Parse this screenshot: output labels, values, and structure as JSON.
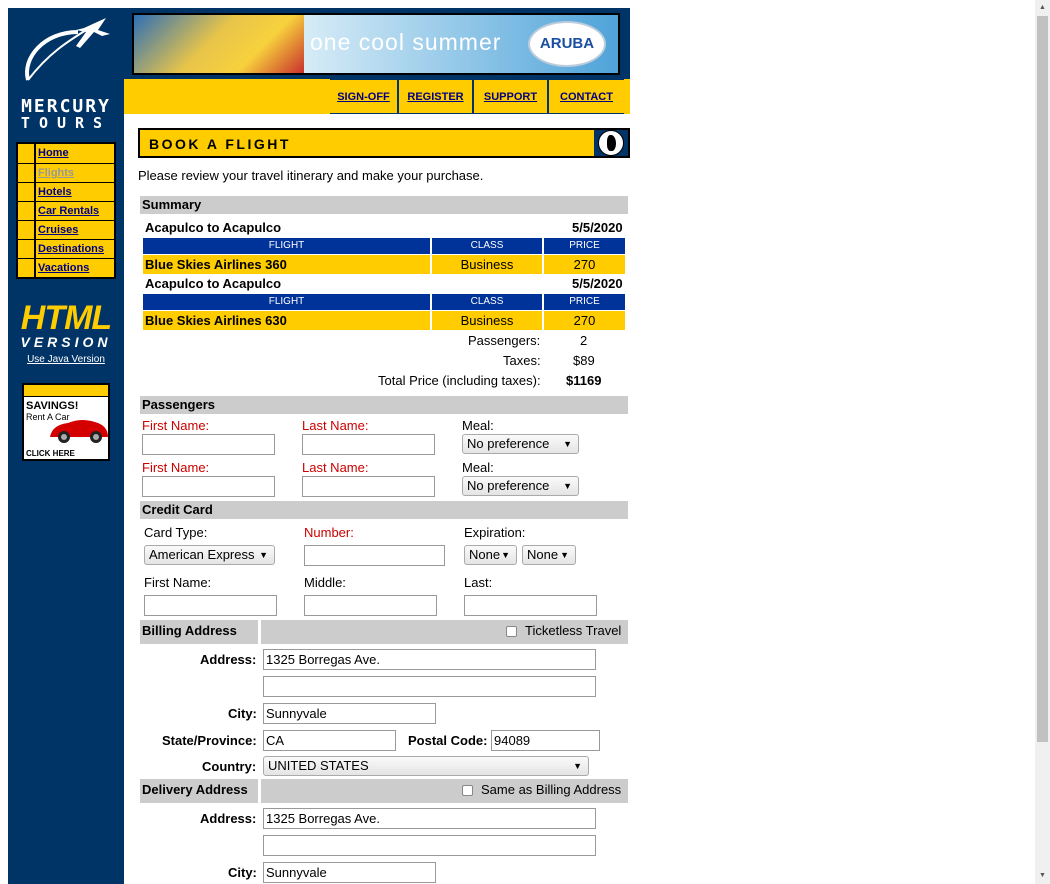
{
  "sidebar": {
    "logo_line1": "MERCURY",
    "logo_line2": "TOURS",
    "nav": [
      {
        "label": "Home"
      },
      {
        "label": "Flights"
      },
      {
        "label": "Hotels"
      },
      {
        "label": "Car Rentals"
      },
      {
        "label": "Cruises"
      },
      {
        "label": "Destinations"
      },
      {
        "label": "Vacations"
      }
    ],
    "html_logo_top": "HTML",
    "html_logo_bottom": "VERSION",
    "java_link": "Use Java Version",
    "ad": {
      "headline": "SAVINGS!",
      "sub": "Rent A Car",
      "cta": "CLICK HERE"
    }
  },
  "banner": {
    "text": "one cool summer",
    "badge": "ARUBA"
  },
  "topnav": [
    "SIGN-OFF",
    "REGISTER",
    "SUPPORT",
    "CONTACT"
  ],
  "page_title": "BOOK A FLIGHT",
  "intro": "Please review your travel itinerary and make your purchase.",
  "summary": {
    "heading": "Summary",
    "legs": [
      {
        "route": "Acapulco to Acapulco",
        "date": "5/5/2020",
        "flight": "Blue Skies Airlines 360",
        "class": "Business",
        "price": "270"
      },
      {
        "route": "Acapulco to Acapulco",
        "date": "5/5/2020",
        "flight": "Blue Skies Airlines 630",
        "class": "Business",
        "price": "270"
      }
    ],
    "col_flight": "FLIGHT",
    "col_class": "CLASS",
    "col_price": "PRICE",
    "passengers_label": "Passengers:",
    "passengers_value": "2",
    "taxes_label": "Taxes:",
    "taxes_value": "$89",
    "total_label": "Total Price (including taxes):",
    "total_value": "$1169"
  },
  "passengers": {
    "heading": "Passengers",
    "first_label": "First Name:",
    "last_label": "Last Name:",
    "meal_label": "Meal:",
    "meal_value": "No preference"
  },
  "credit_card": {
    "heading": "Credit Card",
    "type_label": "Card Type:",
    "type_value": "American Express",
    "number_label": "Number:",
    "exp_label": "Expiration:",
    "exp_month": "None",
    "exp_year": "None",
    "first_label": "First Name:",
    "middle_label": "Middle:",
    "last_label": "Last:"
  },
  "billing": {
    "heading": "Billing Address",
    "ticketless": "Ticketless Travel",
    "address_label": "Address:",
    "address1": "1325 Borregas Ave.",
    "address2": "",
    "city_label": "City:",
    "city": "Sunnyvale",
    "state_label": "State/Province:",
    "state": "CA",
    "postal_label": "Postal Code:",
    "postal": "94089",
    "country_label": "Country:",
    "country": "UNITED STATES"
  },
  "delivery": {
    "heading": "Delivery Address",
    "same_as": "Same as Billing Address",
    "address_label": "Address:",
    "address1": "1325 Borregas Ave.",
    "address2": "",
    "city_label": "City:",
    "city": "Sunnyvale"
  }
}
